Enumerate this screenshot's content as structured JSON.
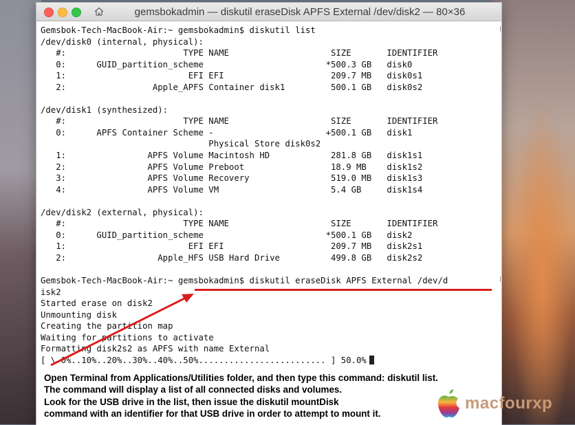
{
  "window": {
    "title": "gemsbokadmin — diskutil eraseDisk APFS External /dev/disk2 — 80×36"
  },
  "terminal": {
    "lines": [
      "Gemsbok-Tech-MacBook-Air:~ gemsbokadmin$ diskutil list",
      "/dev/disk0 (internal, physical):",
      "   #:                       TYPE NAME                    SIZE       IDENTIFIER",
      "   0:      GUID_partition_scheme                        *500.3 GB   disk0",
      "   1:                        EFI EFI                     209.7 MB   disk0s1",
      "   2:                 Apple_APFS Container disk1         500.1 GB   disk0s2",
      "",
      "/dev/disk1 (synthesized):",
      "   #:                       TYPE NAME                    SIZE       IDENTIFIER",
      "   0:      APFS Container Scheme -                      +500.1 GB   disk1",
      "                                 Physical Store disk0s2",
      "   1:                APFS Volume Macintosh HD            281.8 GB   disk1s1",
      "   2:                APFS Volume Preboot                 18.9 MB    disk1s2",
      "   3:                APFS Volume Recovery                519.0 MB   disk1s3",
      "   4:                APFS Volume VM                      5.4 GB     disk1s4",
      "",
      "/dev/disk2 (external, physical):",
      "   #:                       TYPE NAME                    SIZE       IDENTIFIER",
      "   0:      GUID_partition_scheme                        *500.1 GB   disk2",
      "   1:                        EFI EFI                     209.7 MB   disk2s1",
      "   2:                  Apple_HFS USB Hard Drive          499.8 GB   disk2s2",
      "",
      "Gemsbok-Tech-MacBook-Air:~ gemsbokadmin$ diskutil eraseDisk APFS External /dev/d",
      "isk2",
      "Started erase on disk2",
      "Unmounting disk",
      "Creating the partition map",
      "Waiting for partitions to activate",
      "Formatting disk2s2 as APFS with name External",
      "[ \\ 0%..10%..20%..30%..40%..50%......................... ] 50.0%"
    ]
  },
  "annotation": {
    "caption_lines": [
      "Open Terminal from Applications/Utilities folder, and then type this command: diskutil list.",
      "The command will display a list of all connected disks and volumes.",
      "Look for the USB drive in the list, then issue the diskutil mountDisk",
      "command with an identifier for that USB drive in order to attempt to mount it."
    ],
    "highlight_color": "#d91d1d"
  },
  "watermark": {
    "text": "macfourxp"
  }
}
